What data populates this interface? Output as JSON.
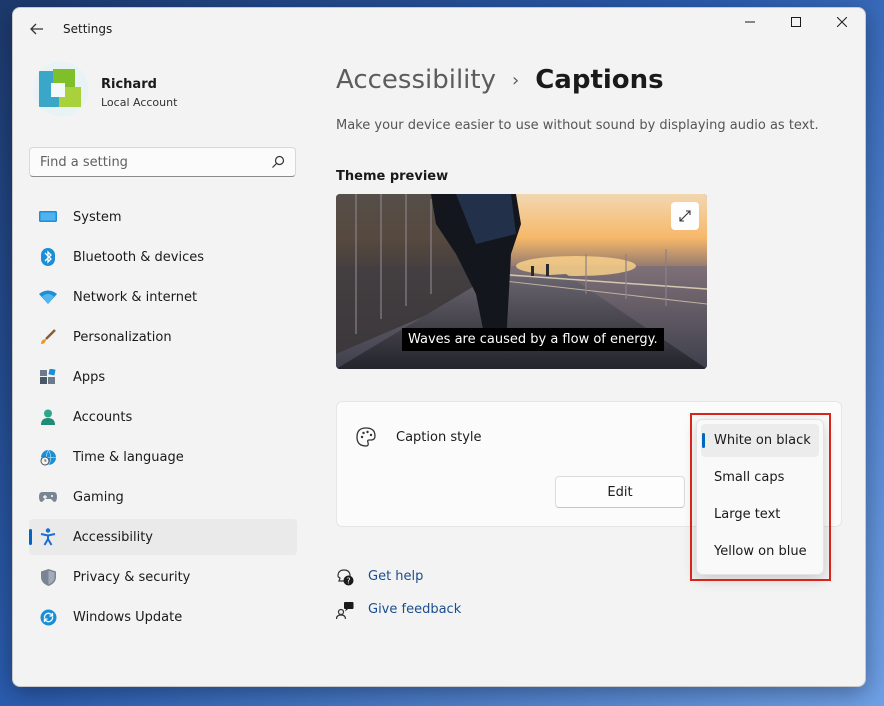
{
  "window": {
    "title": "Settings"
  },
  "profile": {
    "name": "Richard",
    "account_type": "Local Account"
  },
  "search": {
    "placeholder": "Find a setting"
  },
  "nav": {
    "items": [
      {
        "label": "System",
        "icon": "system-icon",
        "active": false
      },
      {
        "label": "Bluetooth & devices",
        "icon": "bluetooth-icon",
        "active": false
      },
      {
        "label": "Network & internet",
        "icon": "wifi-icon",
        "active": false
      },
      {
        "label": "Personalization",
        "icon": "brush-icon",
        "active": false
      },
      {
        "label": "Apps",
        "icon": "apps-icon",
        "active": false
      },
      {
        "label": "Accounts",
        "icon": "person-icon",
        "active": false
      },
      {
        "label": "Time & language",
        "icon": "globe-clock-icon",
        "active": false
      },
      {
        "label": "Gaming",
        "icon": "gamepad-icon",
        "active": false
      },
      {
        "label": "Accessibility",
        "icon": "accessibility-icon",
        "active": true
      },
      {
        "label": "Privacy & security",
        "icon": "shield-icon",
        "active": false
      },
      {
        "label": "Windows Update",
        "icon": "update-icon",
        "active": false
      }
    ]
  },
  "breadcrumb": {
    "parent": "Accessibility",
    "separator": "›",
    "current": "Captions"
  },
  "page": {
    "description": "Make your device easier to use without sound by displaying audio as text.",
    "theme_preview_title": "Theme preview",
    "preview_caption": "Waves are caused by a flow of energy."
  },
  "caption_style": {
    "label": "Caption style",
    "edit_label": "Edit",
    "options": [
      "White on black",
      "Small caps",
      "Large text",
      "Yellow on blue"
    ],
    "selected": "White on black"
  },
  "links": {
    "help": "Get help",
    "feedback": "Give feedback"
  },
  "colors": {
    "accent": "#0067c0",
    "highlight": "#d9241c",
    "link": "#1a4d8f"
  }
}
